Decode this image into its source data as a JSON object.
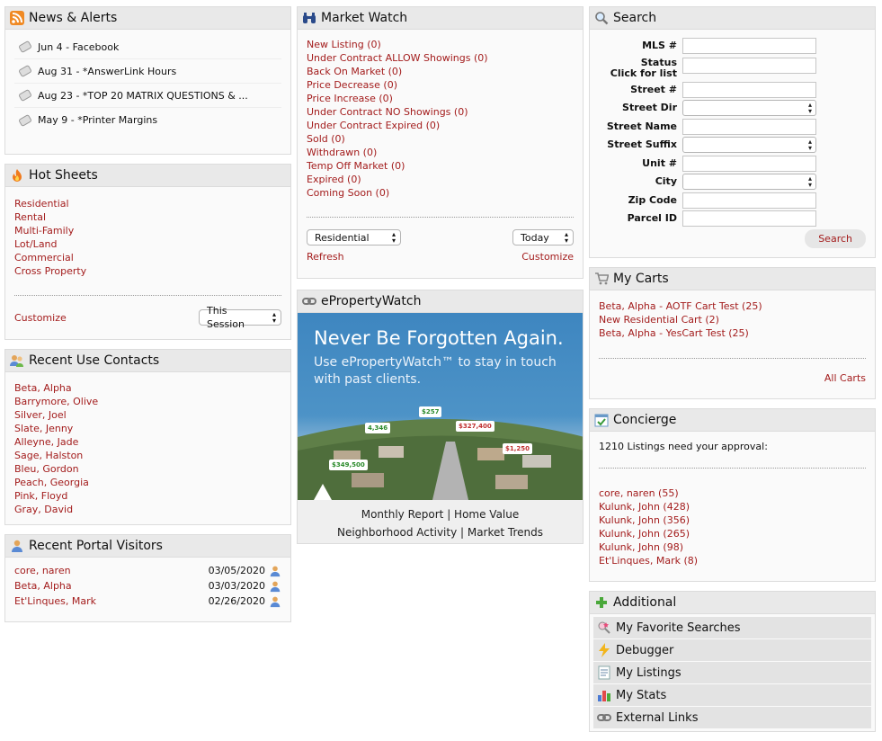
{
  "news": {
    "title": "News & Alerts",
    "items": [
      {
        "date": "Jun 4",
        "text": "Jun 4 - Facebook"
      },
      {
        "date": "Aug 31",
        "text": "Aug 31 - *AnswerLink Hours"
      },
      {
        "date": "Aug 23",
        "text": "Aug 23 - *TOP 20 MATRIX QUESTIONS & ..."
      },
      {
        "date": "May 9",
        "text": "May 9 - *Printer Margins"
      }
    ]
  },
  "hot_sheets": {
    "title": "Hot Sheets",
    "items": [
      "Residential",
      "Rental",
      "Multi-Family",
      "Lot/Land",
      "Commercial",
      "Cross Property"
    ],
    "customize": "Customize",
    "period": "This Session"
  },
  "recent_contacts": {
    "title": "Recent Use Contacts",
    "items": [
      "Beta, Alpha",
      "Barrymore, Olive",
      "Silver, Joel",
      "Slate, Jenny",
      "Alleyne, Jade",
      "Sage, Halston",
      "Bleu, Gordon",
      "Peach, Georgia",
      "Pink, Floyd",
      "Gray, David"
    ]
  },
  "portal_visitors": {
    "title": "Recent Portal Visitors",
    "items": [
      {
        "name": "core, naren",
        "date": "03/05/2020"
      },
      {
        "name": "Beta, Alpha",
        "date": "03/03/2020"
      },
      {
        "name": "Et'Linques, Mark",
        "date": "02/26/2020"
      }
    ]
  },
  "market_watch": {
    "title": "Market Watch",
    "items": [
      "New Listing (0)",
      "Under Contract ALLOW Showings (0)",
      "Back On Market (0)",
      "Price Decrease (0)",
      "Price Increase (0)",
      "Under Contract NO Showings (0)",
      "Under Contract Expired (0)",
      "Sold (0)",
      "Withdrawn (0)",
      "Temp Off Market (0)",
      "Expired (0)",
      "Coming Soon (0)"
    ],
    "property_type": "Residential",
    "period": "Today",
    "refresh": "Refresh",
    "customize": "Customize"
  },
  "epropertywatch": {
    "title": "ePropertyWatch",
    "headline": "Never Be Forgotten Again.",
    "subhead": "Use ePropertyWatch™ to stay in touch with past clients.",
    "tags": [
      "$257",
      "4,346",
      "$327,400",
      "$1,250",
      "$349,500"
    ],
    "footer_line1": "Monthly Report | Home Value",
    "footer_line2": "Neighborhood Activity | Market Trends"
  },
  "search": {
    "title": "Search",
    "fields": {
      "mls": "MLS #",
      "status": "Status",
      "status_hint": "Click for list",
      "street_num": "Street #",
      "street_dir": "Street Dir",
      "street_name": "Street Name",
      "street_suffix": "Street Suffix",
      "unit": "Unit #",
      "city": "City",
      "zip": "Zip Code",
      "parcel": "Parcel ID"
    },
    "button": "Search"
  },
  "carts": {
    "title": "My Carts",
    "items": [
      "Beta, Alpha - AOTF Cart Test (25)",
      "New Residential Cart (2)",
      "Beta, Alpha - YesCart Test (25)"
    ],
    "all": "All Carts"
  },
  "concierge": {
    "title": "Concierge",
    "summary": "1210 Listings need your approval:",
    "items": [
      "core, naren (55)",
      "Kulunk, John (428)",
      "Kulunk, John (356)",
      "Kulunk, John (265)",
      "Kulunk, John (98)",
      "Et'Linques, Mark (8)"
    ]
  },
  "additional": {
    "title": "Additional",
    "items": [
      {
        "label": "My Favorite Searches",
        "icon": "favorite-searches-icon"
      },
      {
        "label": "Debugger",
        "icon": "lightning-icon"
      },
      {
        "label": "My Listings",
        "icon": "document-icon"
      },
      {
        "label": "My Stats",
        "icon": "bar-chart-icon"
      },
      {
        "label": "External Links",
        "icon": "link-icon"
      }
    ]
  },
  "colors": {
    "link": "#a31c1c",
    "header_bg": "#e9e9e9",
    "panel_bg": "#fafafa",
    "banner_blue": "#3e86c0"
  }
}
